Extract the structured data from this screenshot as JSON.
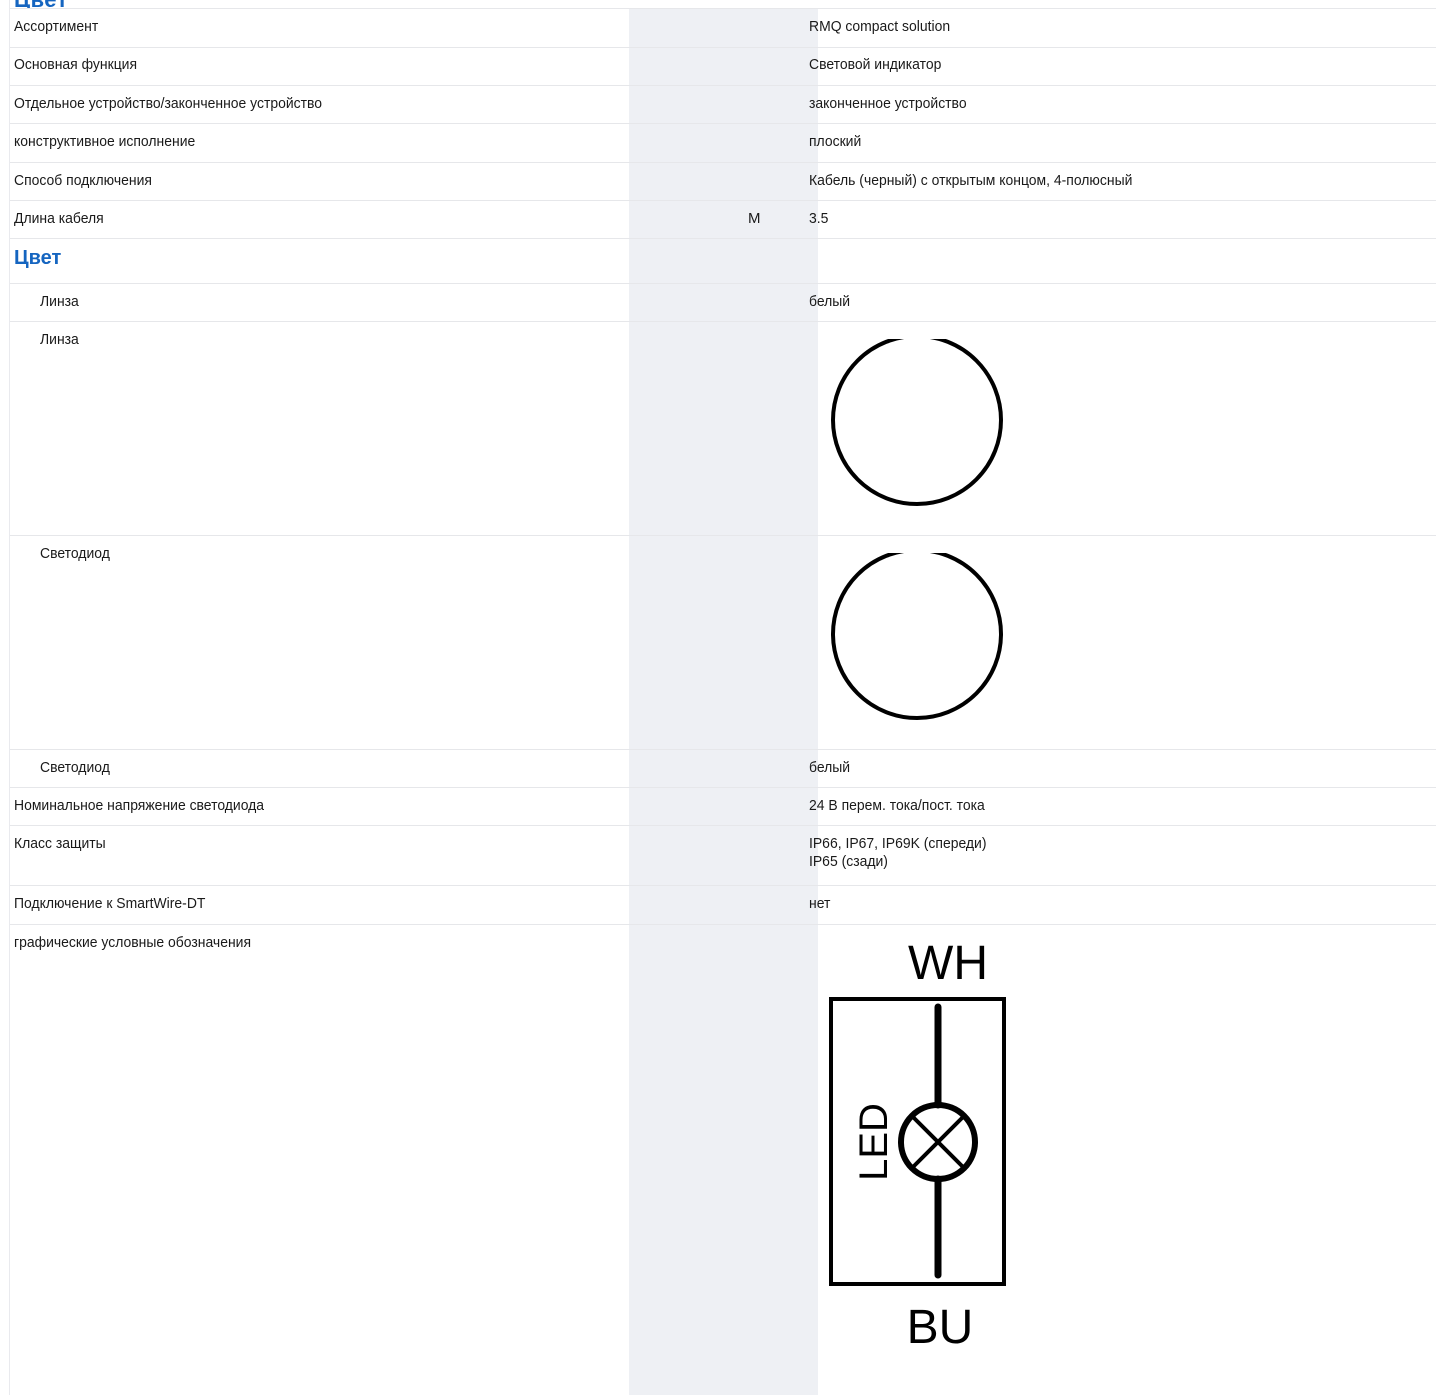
{
  "header": {
    "partial_title": "Цвет"
  },
  "rows": [
    {
      "label": "Ассортимент",
      "unit": "",
      "value": "RMQ compact solution"
    },
    {
      "label": "Основная функция",
      "unit": "",
      "value": "Световой индикатор"
    },
    {
      "label": "Отдельное устройство/законченное устройство",
      "unit": "",
      "value": "законченное устройство"
    },
    {
      "label": "конструктивное исполнение",
      "unit": "",
      "value": "плоский"
    },
    {
      "label": "Способ подключения",
      "unit": "",
      "value": "Кабель (черный) с открытым концом, 4-полюсный"
    },
    {
      "label": "Длина кабеля",
      "unit": "M",
      "value": "3.5"
    }
  ],
  "color_section": {
    "title": "Цвет",
    "lens_label": "Линза",
    "lens_value": "белый",
    "lens_icon_label": "Линза",
    "led_icon_label": "Светодиод",
    "led_label": "Светодиод",
    "led_value": "белый"
  },
  "rows2": [
    {
      "label": "Номинальное напряжение светодиода",
      "value": "24 В перем. тока/пост. тока"
    },
    {
      "label": "Класс защиты",
      "value_lines": [
        "IP66, IP67, IP69K (спереди)",
        "IP65 (сзади)"
      ]
    },
    {
      "label": "Подключение к SmartWire-DT",
      "value": "нет"
    },
    {
      "label": "графические условные обозначения"
    }
  ],
  "symbol": {
    "top": "WH",
    "bottom": "BU",
    "side": "LED"
  },
  "icons": {
    "lens": "circle-icon",
    "led": "circle-icon",
    "schematic": "led-lamp-symbol"
  }
}
